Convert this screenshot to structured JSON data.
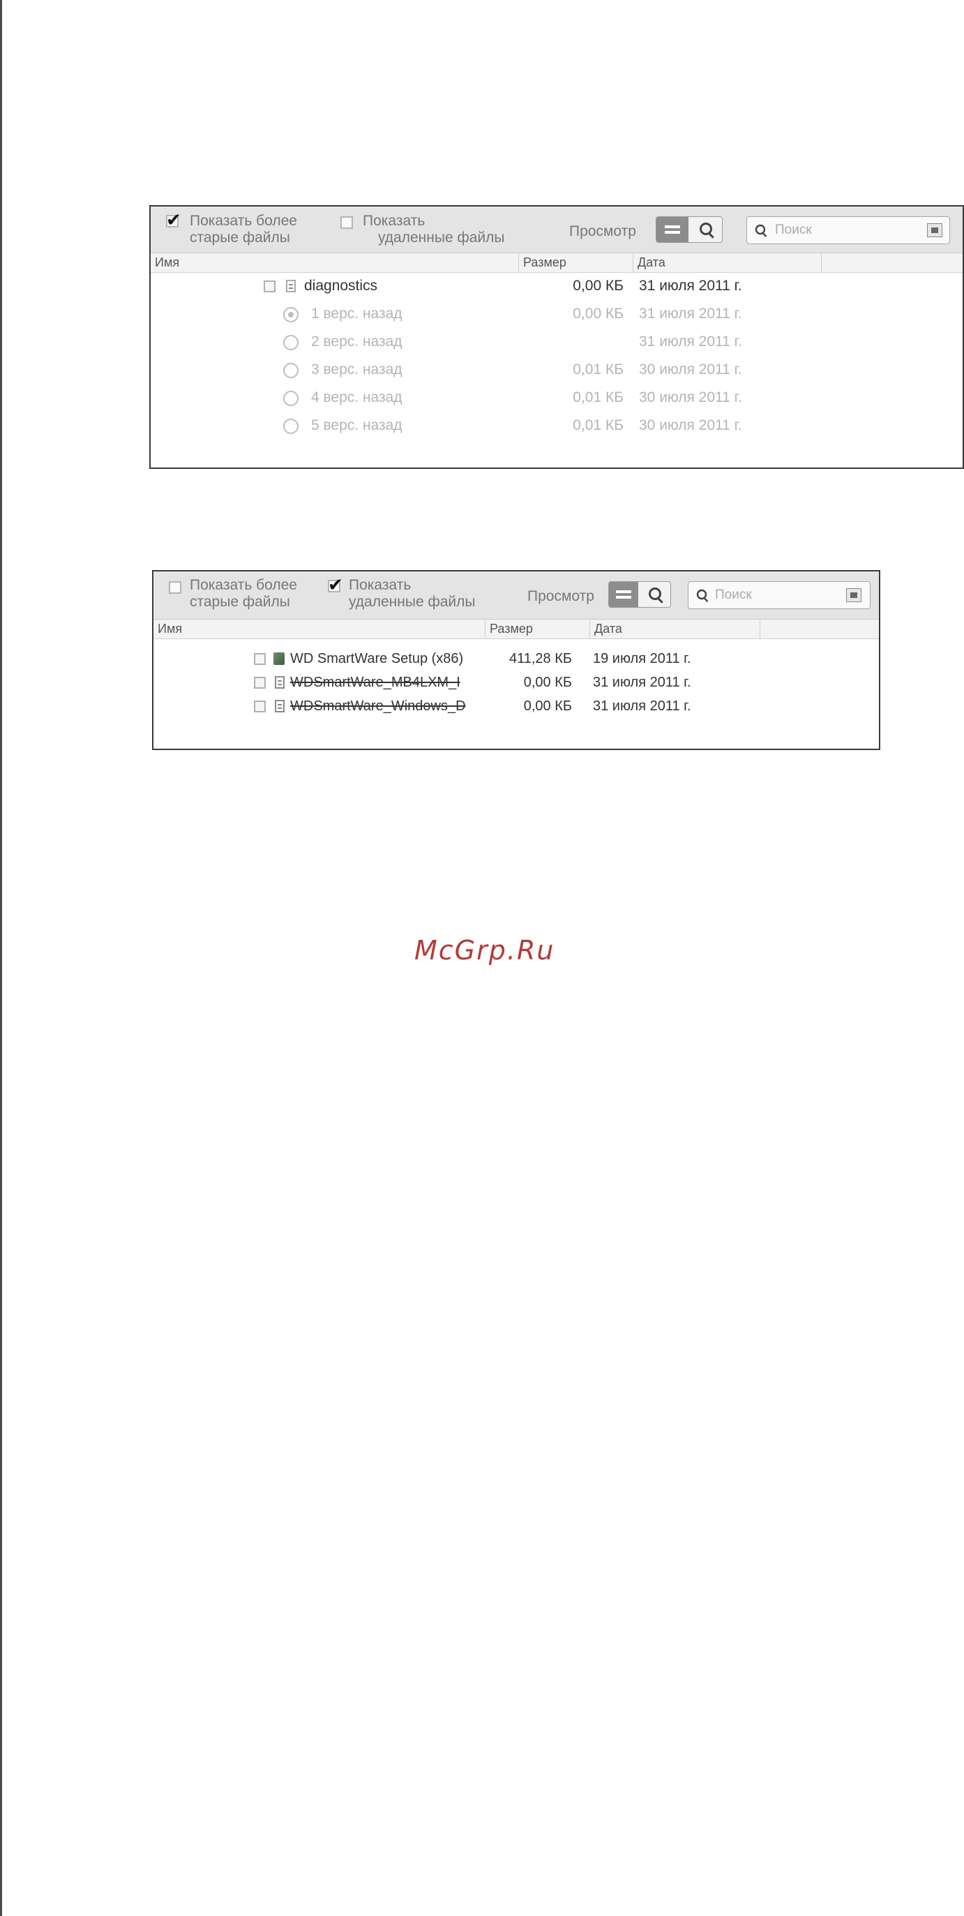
{
  "panel1": {
    "toolbar": {
      "show_old_files": [
        "Показать более",
        "старые файлы"
      ],
      "show_old_checked": true,
      "show_deleted_files": [
        "Показать",
        "удаленные файлы"
      ],
      "show_deleted_checked": false,
      "view_label": "Просмотр",
      "search_placeholder": "Поиск"
    },
    "columns": [
      "Имя",
      "Размер",
      "Дата"
    ],
    "rows": [
      {
        "name": "diagnostics",
        "size": "0,00 КБ",
        "date": "31 июля 2011 г."
      },
      {
        "name": "1 верс. назад",
        "size": "0,00 КБ",
        "date": "31 июля 2011 г."
      },
      {
        "name": "2 верс. назад",
        "size": "",
        "date": "31 июля 2011 г."
      },
      {
        "name": "3 верс. назад",
        "size": "0,01 КБ",
        "date": "30 июля 2011 г."
      },
      {
        "name": "4 верс. назад",
        "size": "0,01 КБ",
        "date": "30 июля 2011 г."
      },
      {
        "name": "5 верс. назад",
        "size": "0,01 КБ",
        "date": "30 июля 2011 г."
      }
    ]
  },
  "panel2": {
    "toolbar": {
      "show_old_files": [
        "Показать более",
        "старые файлы"
      ],
      "show_old_checked": false,
      "show_deleted_files": [
        "Показать",
        "удаленные файлы"
      ],
      "show_deleted_checked": true,
      "view_label": "Просмотр",
      "search_placeholder": "Поиск"
    },
    "columns": [
      "Имя",
      "Размер",
      "Дата"
    ],
    "rows": [
      {
        "name": "WD SmartWare Setup (x86)",
        "size": "411,28 КБ",
        "date": "19 июля 2011 г."
      },
      {
        "name": "WDSmartWare_MB4LXM_I",
        "size": "0,00 КБ",
        "date": "31 июля 2011 г."
      },
      {
        "name": "WDSmartWare_Windows_D",
        "size": "0,00 КБ",
        "date": "31 июля 2011 г."
      }
    ]
  },
  "watermark": "McGrp.Ru",
  "icons": {
    "list_view": "list-view-icon",
    "search": "magnifier-icon",
    "clear": "clear-icon",
    "file": "document-icon",
    "app": "application-icon",
    "version": "radio-icon"
  }
}
